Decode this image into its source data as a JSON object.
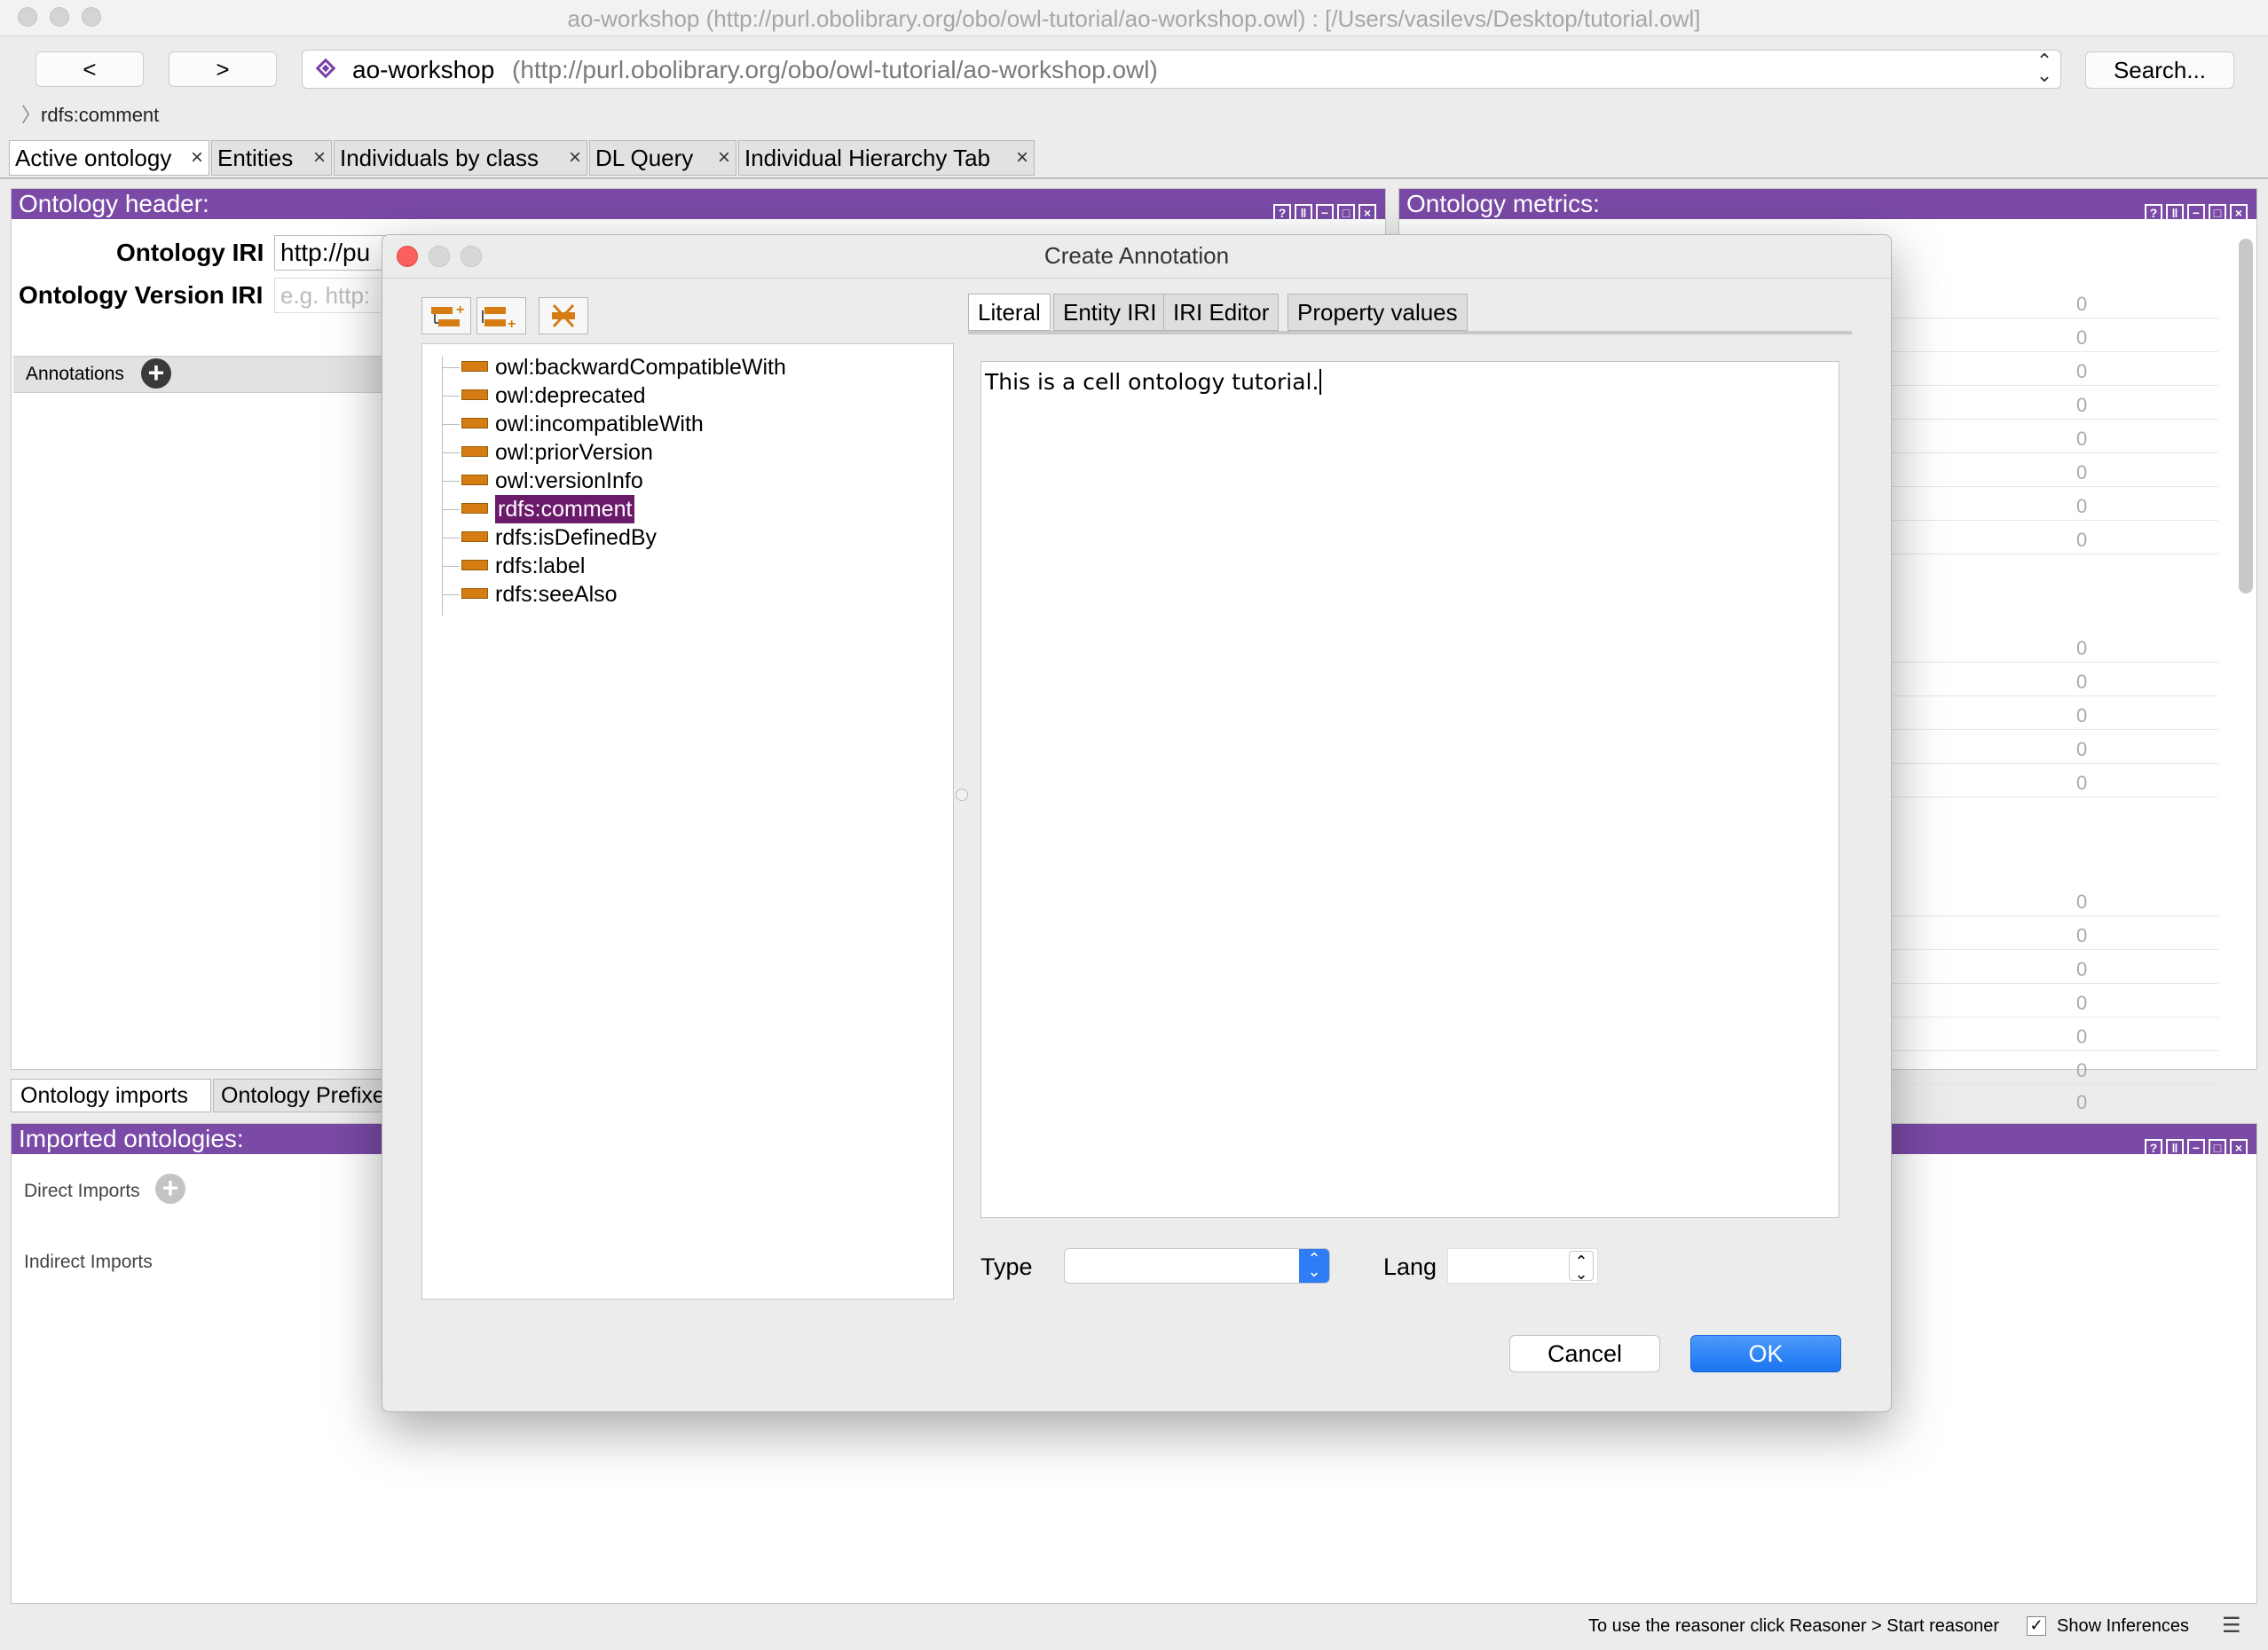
{
  "window": {
    "title": "ao-workshop (http://purl.obolibrary.org/obo/owl-tutorial/ao-workshop.owl)  : [/Users/vasilevs/Desktop/tutorial.owl]"
  },
  "nav": {
    "back": "<",
    "forward": ">",
    "ontology_name": "ao-workshop",
    "ontology_iri": "(http://purl.obolibrary.org/obo/owl-tutorial/ao-workshop.owl)",
    "search": "Search..."
  },
  "breadcrumb": "rdfs:comment",
  "tabs": [
    {
      "label": "Active ontology"
    },
    {
      "label": "Entities"
    },
    {
      "label": "Individuals by class"
    },
    {
      "label": "DL Query"
    },
    {
      "label": "Individual Hierarchy Tab"
    }
  ],
  "header_panel": {
    "title": "Ontology header:",
    "iri_label": "Ontology IRI",
    "iri_value": "http://pu",
    "version_label": "Ontology Version IRI",
    "version_placeholder": "e.g. http:"
  },
  "annotations": {
    "label": "Annotations"
  },
  "metrics_panel": {
    "title": "Ontology metrics:",
    "values": [
      "0",
      "0",
      "0",
      "0",
      "0",
      "0",
      "0",
      "0",
      "0",
      "0",
      "0",
      "0",
      "0",
      "0",
      "0",
      "0",
      "0",
      "0",
      "0",
      "0"
    ]
  },
  "bottom_tabs": [
    {
      "label": "Ontology imports"
    },
    {
      "label": "Ontology Prefixe"
    }
  ],
  "imports_panel": {
    "title": "Imported ontologies:",
    "direct": "Direct Imports",
    "indirect": "Indirect Imports"
  },
  "dialog": {
    "title": "Create Annotation",
    "properties": [
      "owl:backwardCompatibleWith",
      "owl:deprecated",
      "owl:incompatibleWith",
      "owl:priorVersion",
      "owl:versionInfo",
      "rdfs:comment",
      "rdfs:isDefinedBy",
      "rdfs:label",
      "rdfs:seeAlso"
    ],
    "selected": "rdfs:comment",
    "tabs": [
      {
        "label": "Literal"
      },
      {
        "label": "Entity IRI"
      },
      {
        "label": "IRI Editor"
      },
      {
        "label": "Property values"
      }
    ],
    "literal_text": "This is a cell ontology tutorial.",
    "type_label": "Type",
    "type_value": "",
    "lang_label": "Lang",
    "lang_value": "",
    "cancel": "Cancel",
    "ok": "OK"
  },
  "status": {
    "reasoner_hint": "To use the reasoner click Reasoner > Start reasoner",
    "show_inferences": "Show Inferences",
    "show_inferences_checked": true
  },
  "colors": {
    "panel_header": "#7a4aa6",
    "selection": "#6b1a6b",
    "ok_button": "#1f7ef5",
    "property_icon": "#d57d12"
  }
}
